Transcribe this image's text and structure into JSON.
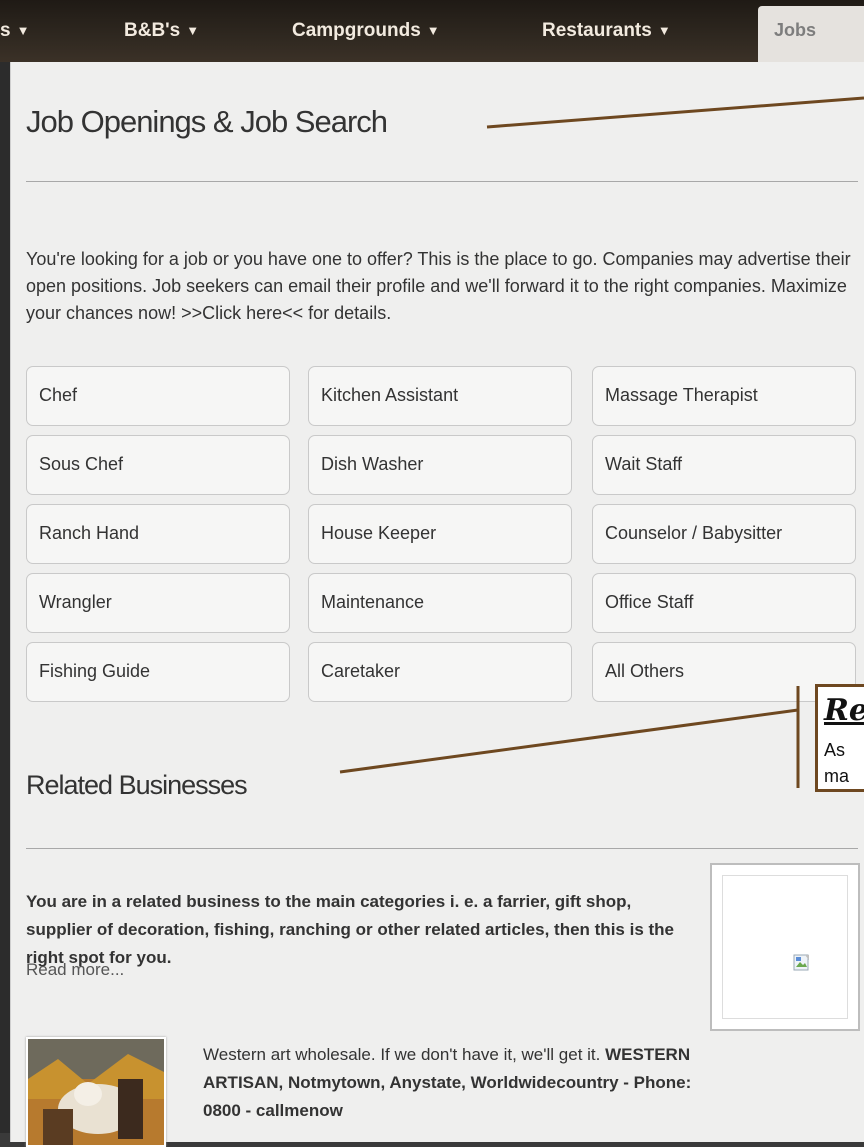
{
  "nav": {
    "items": [
      {
        "label": "s"
      },
      {
        "label": "B&B's"
      },
      {
        "label": "Campgrounds"
      },
      {
        "label": "Restaurants"
      }
    ],
    "active": "Jobs"
  },
  "jobs_section": {
    "title": "Job Openings & Job Search",
    "intro": "You're looking for a job or you have one to offer? This is the place to go. Companies may advertise their open positions. Job seekers can email their profile and we'll forward it to the right companies. Maximize your chances now! >>Click here<< for details.",
    "categories": [
      "Chef",
      "Kitchen Assistant",
      "Massage Therapist",
      "Sous Chef",
      "Dish Washer",
      "Wait Staff",
      "Ranch Hand",
      "House Keeper",
      "Counselor / Babysitter",
      "Wrangler",
      "Maintenance",
      "Office Staff",
      "Fishing Guide",
      "Caretaker",
      "All Others"
    ]
  },
  "related_section": {
    "title": "Related Businesses",
    "text": "You are in a related business to the main categories i. e. a farrier, gift shop, supplier of decoration, fishing, ranching or other related articles, then this is the right spot for you.",
    "read_more": "Read more...",
    "listing_text": "Western art wholesale. If we don't have it, we'll get it.",
    "listing_bold": "WESTERN ARTISAN, Notmytown, Anystate, Worldwidecountry - Phone: 0800 - callmenow"
  },
  "callout": {
    "title": "Re",
    "line1": "As",
    "line2": "ma"
  },
  "colors": {
    "annotation": "#6e4820",
    "nav_bg": "#2f2820",
    "panel_bg": "#efefee"
  }
}
